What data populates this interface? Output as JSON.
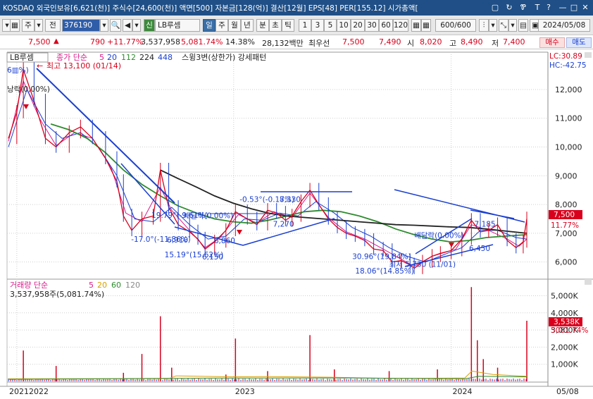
{
  "titlebar": {
    "text": "KOSDAQ 외국인보유[6,621(천)] 주식수[24,600(천)] 액면[500] 자본금[128(억)] 결산[12월] EPS[48] PER[155.12] 시가총액[",
    "icons": [
      "window-icon",
      "sync-icon",
      "pin-icon",
      "text-icon",
      "help-icon",
      "minimize-icon",
      "maximize-icon",
      "close-icon"
    ],
    "buttons": [
      "▢",
      "↻",
      "Ꮘ",
      "T",
      "?",
      "—",
      "□",
      "✕"
    ]
  },
  "toolbar": {
    "market_label": "주",
    "period_label": "전",
    "code": "376190",
    "stock_name": "LB루셈",
    "period_tabs": [
      "일",
      "주",
      "월",
      "년",
      "분",
      "초",
      "틱"
    ],
    "selected_tab": "일",
    "minute_options": [
      "1",
      "3",
      "5",
      "10",
      "20",
      "30",
      "60",
      "120"
    ],
    "count": "600/600",
    "date": "2024/05/08",
    "new_badge": "신"
  },
  "quote": {
    "price": "7,500",
    "arrow": "▲",
    "change": "790",
    "change_pct": "+11.77%",
    "volume": "3,537,958",
    "volume_pct": "5,081.74%",
    "turnover_pct": "14.38%",
    "amount": "28,132백만",
    "ask_label": "최우선",
    "ask": "7,500",
    "bid": "7,490",
    "open_label": "시",
    "open": "8,020",
    "high_label": "고",
    "high": "8,490",
    "low_label": "저",
    "low": "7,400",
    "buy_label": "매수",
    "sell_label": "매도"
  },
  "chart_panel": {
    "name": "LB루셈",
    "ma_label": "종가 단순",
    "ma_periods": [
      "5",
      "20",
      "112",
      "224",
      "448"
    ],
    "pattern_label": "스윙3변(상한가) 강세패턴",
    "lc": "LC:30.89",
    "hc": "HC:-42.75",
    "max_label": "최고 13,100 (01/14)",
    "corner_label": "6▥%)",
    "left_label": "낭락(0,00%)",
    "price_tag": "7,500",
    "pct_tag": "11.77%",
    "annotations": [
      {
        "text": "-0.53°(-0.17%)",
        "x": "2023-01-12",
        "y": 8090
      },
      {
        "text": "8,330",
        "x": "2023-03-20",
        "y": 8090
      },
      {
        "text": "19.79°(-9.61%)",
        "x": "2022-08-17",
        "y": 7540
      },
      {
        "text": "배달락(0.00%)",
        "x": "2022-10-10",
        "y": 7520
      },
      {
        "text": "-17.0°(-11.86%)",
        "x": "2022-07-14",
        "y": 6700
      },
      {
        "text": "6,910",
        "x": "2022-09-12",
        "y": 6680
      },
      {
        "text": "6,860",
        "x": "2022-11-30",
        "y": 6650
      },
      {
        "text": "7,270",
        "x": "2023-03-09",
        "y": 7230
      },
      {
        "text": "15.19°(15.62%)",
        "x": "2022-09-08",
        "y": 6170
      },
      {
        "text": "6,150",
        "x": "2022-11-10",
        "y": 6090
      },
      {
        "text": "30.96°(19.84%)",
        "x": "2023-07-20",
        "y": 6100
      },
      {
        "text": "최저 5,730 (11/01)",
        "x": "2023-09-20",
        "y": 5830
      },
      {
        "text": "18.06°(14.85%)",
        "x": "2023-07-25",
        "y": 5600
      },
      {
        "text": "배달락(0.00%)",
        "x": "2023-11-01",
        "y": 6840
      },
      {
        "text": "7,185",
        "x": "2024-02-10",
        "y": 7230
      },
      {
        "text": "6,450",
        "x": "2024-02-01",
        "y": 6380
      }
    ]
  },
  "volume_panel": {
    "label": "거래량 단순",
    "ma_periods": [
      "5",
      "20",
      "60",
      "120"
    ],
    "volume_text": "3,537,958주(5,081.74%)",
    "tag_value": "3,538K",
    "tag_pct": "5081.74%"
  },
  "colors": {
    "up": "#d8001c",
    "down": "#1a3fd0",
    "ma5": "#d81b8b",
    "ma20": "#1a3fd0",
    "ma112": "#2e8b2e",
    "ma224": "#222222",
    "ma448": "#e07800",
    "trend": "#1a3fd0"
  },
  "chart_data": [
    {
      "type": "line",
      "title": "LB루셈",
      "x_start": "2021-12-20",
      "x_end": "2024-05-08",
      "ylim": [
        5600,
        13200
      ],
      "y_ticks": [
        6000,
        7000,
        8000,
        9000,
        10000,
        11000,
        12000
      ],
      "y_tick_labels": [
        "6,000",
        "7,000",
        "8,000",
        "9,000",
        "10,000",
        "11,000",
        "12,000"
      ],
      "x_tick_labels": [
        {
          "x": "2021-12-20",
          "text": "2021"
        },
        {
          "x": "2022-01-03",
          "text": "2022"
        },
        {
          "x": "2023-01-02",
          "text": "2023"
        },
        {
          "x": "2024-01-02",
          "text": "2024"
        },
        {
          "x": "2024-05-08",
          "text": "05/08"
        }
      ],
      "grid": true,
      "series": [
        {
          "name": "종가",
          "points": [
            [
              "2021-12-20",
              10300
            ],
            [
              "2022-01-03",
              11200
            ],
            [
              "2022-01-14",
              12700
            ],
            [
              "2022-02-01",
              11600
            ],
            [
              "2022-02-20",
              10300
            ],
            [
              "2022-03-10",
              10000
            ],
            [
              "2022-04-01",
              10500
            ],
            [
              "2022-04-20",
              10700
            ],
            [
              "2022-05-10",
              10300
            ],
            [
              "2022-06-01",
              9600
            ],
            [
              "2022-06-20",
              8800
            ],
            [
              "2022-07-01",
              7600
            ],
            [
              "2022-07-15",
              7100
            ],
            [
              "2022-08-01",
              7500
            ],
            [
              "2022-08-20",
              7600
            ],
            [
              "2022-09-01",
              9200
            ],
            [
              "2022-09-15",
              7900
            ],
            [
              "2022-10-01",
              7300
            ],
            [
              "2022-10-20",
              7050
            ],
            [
              "2022-11-03",
              6800
            ],
            [
              "2022-11-15",
              6450
            ],
            [
              "2022-12-01",
              6700
            ],
            [
              "2022-12-20",
              7100
            ],
            [
              "2023-01-05",
              7750
            ],
            [
              "2023-01-25",
              7500
            ],
            [
              "2023-02-10",
              7300
            ],
            [
              "2023-02-28",
              7800
            ],
            [
              "2023-03-15",
              7700
            ],
            [
              "2023-03-30",
              7450
            ],
            [
              "2023-04-10",
              7600
            ],
            [
              "2023-04-25",
              8100
            ],
            [
              "2023-05-10",
              8500
            ],
            [
              "2023-05-25",
              8000
            ],
            [
              "2023-06-10",
              7500
            ],
            [
              "2023-06-25",
              7200
            ],
            [
              "2023-07-10",
              7000
            ],
            [
              "2023-07-25",
              6900
            ],
            [
              "2023-08-10",
              6750
            ],
            [
              "2023-08-25",
              6450
            ],
            [
              "2023-09-10",
              6400
            ],
            [
              "2023-09-25",
              6000
            ],
            [
              "2023-10-10",
              6050
            ],
            [
              "2023-10-25",
              5900
            ],
            [
              "2023-11-01",
              5780
            ],
            [
              "2023-11-15",
              6000
            ],
            [
              "2023-12-01",
              6200
            ],
            [
              "2023-12-15",
              6300
            ],
            [
              "2024-01-02",
              6400
            ],
            [
              "2024-01-20",
              6800
            ],
            [
              "2024-02-05",
              7450
            ],
            [
              "2024-02-20",
              7050
            ],
            [
              "2024-03-05",
              7100
            ],
            [
              "2024-03-20",
              7300
            ],
            [
              "2024-04-05",
              6750
            ],
            [
              "2024-04-20",
              6500
            ],
            [
              "2024-05-02",
              6700
            ],
            [
              "2024-05-08",
              7500
            ]
          ]
        },
        {
          "name": "5",
          "points": [
            [
              "2021-12-20",
              10200
            ],
            [
              "2022-01-14",
              12300
            ],
            [
              "2022-02-10",
              11000
            ],
            [
              "2022-03-10",
              10050
            ],
            [
              "2022-04-10",
              10500
            ],
            [
              "2022-05-10",
              10300
            ],
            [
              "2022-06-10",
              9300
            ],
            [
              "2022-07-05",
              7700
            ],
            [
              "2022-08-01",
              7400
            ],
            [
              "2022-09-01",
              8600
            ],
            [
              "2022-09-20",
              7800
            ],
            [
              "2022-10-20",
              7100
            ],
            [
              "2022-11-15",
              6500
            ],
            [
              "2022-12-10",
              6850
            ],
            [
              "2023-01-10",
              7650
            ],
            [
              "2023-02-10",
              7350
            ],
            [
              "2023-03-10",
              7750
            ],
            [
              "2023-04-10",
              7550
            ],
            [
              "2023-05-10",
              8400
            ],
            [
              "2023-06-10",
              7550
            ],
            [
              "2023-07-10",
              7050
            ],
            [
              "2023-08-10",
              6800
            ],
            [
              "2023-09-10",
              6450
            ],
            [
              "2023-10-10",
              6100
            ],
            [
              "2023-11-01",
              5850
            ],
            [
              "2023-12-01",
              6200
            ],
            [
              "2024-01-10",
              6450
            ],
            [
              "2024-02-05",
              7300
            ],
            [
              "2024-03-05",
              7100
            ],
            [
              "2024-04-05",
              6800
            ],
            [
              "2024-04-25",
              6550
            ],
            [
              "2024-05-08",
              6800
            ]
          ]
        },
        {
          "name": "20",
          "points": [
            [
              "2021-12-20",
              10000
            ],
            [
              "2022-01-20",
              12000
            ],
            [
              "2022-02-20",
              10800
            ],
            [
              "2022-03-20",
              10300
            ],
            [
              "2022-04-20",
              10500
            ],
            [
              "2022-05-20",
              10000
            ],
            [
              "2022-06-20",
              9000
            ],
            [
              "2022-07-20",
              7500
            ],
            [
              "2022-08-20",
              7400
            ],
            [
              "2022-09-20",
              7900
            ],
            [
              "2022-10-20",
              7300
            ],
            [
              "2022-11-20",
              6800
            ],
            [
              "2022-12-20",
              6900
            ],
            [
              "2023-01-20",
              7500
            ],
            [
              "2023-02-20",
              7450
            ],
            [
              "2023-03-20",
              7700
            ],
            [
              "2023-04-20",
              7600
            ],
            [
              "2023-05-20",
              8100
            ],
            [
              "2023-06-20",
              7700
            ],
            [
              "2023-07-20",
              7200
            ],
            [
              "2023-08-20",
              6900
            ],
            [
              "2023-09-20",
              6500
            ],
            [
              "2023-10-20",
              6200
            ],
            [
              "2023-11-20",
              6000
            ],
            [
              "2023-12-20",
              6250
            ],
            [
              "2024-01-20",
              6500
            ],
            [
              "2024-02-20",
              7100
            ],
            [
              "2024-03-20",
              7100
            ],
            [
              "2024-04-20",
              6850
            ],
            [
              "2024-05-08",
              6800
            ]
          ]
        },
        {
          "name": "112",
          "points": [
            [
              "2022-03-01",
              10800
            ],
            [
              "2022-04-01",
              10600
            ],
            [
              "2022-05-01",
              10300
            ],
            [
              "2022-06-01",
              9800
            ],
            [
              "2022-07-01",
              9200
            ],
            [
              "2022-08-01",
              8700
            ],
            [
              "2022-09-01",
              8300
            ],
            [
              "2022-10-01",
              7950
            ],
            [
              "2022-11-01",
              7700
            ],
            [
              "2022-12-01",
              7500
            ],
            [
              "2023-01-01",
              7400
            ],
            [
              "2023-02-01",
              7350
            ],
            [
              "2023-03-01",
              7450
            ],
            [
              "2023-04-01",
              7600
            ],
            [
              "2023-05-01",
              7750
            ],
            [
              "2023-06-01",
              7800
            ],
            [
              "2023-07-01",
              7750
            ],
            [
              "2023-08-01",
              7600
            ],
            [
              "2023-09-01",
              7400
            ],
            [
              "2023-10-01",
              7150
            ],
            [
              "2023-11-01",
              6950
            ],
            [
              "2023-12-01",
              6800
            ],
            [
              "2024-01-01",
              6700
            ],
            [
              "2024-02-01",
              6750
            ],
            [
              "2024-03-01",
              6850
            ],
            [
              "2024-04-01",
              6900
            ],
            [
              "2024-05-08",
              6950
            ]
          ]
        },
        {
          "name": "224",
          "points": [
            [
              "2022-09-01",
              9200
            ],
            [
              "2022-10-01",
              8900
            ],
            [
              "2022-11-01",
              8600
            ],
            [
              "2022-12-01",
              8300
            ],
            [
              "2023-01-01",
              8050
            ],
            [
              "2023-02-01",
              7850
            ],
            [
              "2023-03-01",
              7700
            ],
            [
              "2023-04-01",
              7600
            ],
            [
              "2023-05-01",
              7550
            ],
            [
              "2023-06-01",
              7500
            ],
            [
              "2023-07-01",
              7450
            ],
            [
              "2023-08-01",
              7400
            ],
            [
              "2023-09-01",
              7350
            ],
            [
              "2023-10-01",
              7300
            ],
            [
              "2023-11-01",
              7280
            ],
            [
              "2023-12-01",
              7250
            ],
            [
              "2024-01-01",
              7220
            ],
            [
              "2024-02-01",
              7200
            ],
            [
              "2024-03-01",
              7150
            ],
            [
              "2024-04-01",
              7080
            ],
            [
              "2024-05-08",
              7000
            ]
          ]
        }
      ]
    },
    {
      "type": "bar",
      "title": "거래량",
      "ylim": [
        0,
        5800
      ],
      "y_ticks": [
        1000,
        2000,
        3000,
        4000,
        5000
      ],
      "y_tick_labels": [
        "1,000K",
        "2,000K",
        "3,000K",
        "4,000K",
        "5,000K"
      ],
      "spikes": [
        [
          "2022-01-14",
          1800
        ],
        [
          "2022-03-10",
          900
        ],
        [
          "2022-07-01",
          500
        ],
        [
          "2022-08-01",
          1600
        ],
        [
          "2022-09-01",
          3800
        ],
        [
          "2022-09-20",
          800
        ],
        [
          "2022-12-20",
          400
        ],
        [
          "2023-01-05",
          2500
        ],
        [
          "2023-02-28",
          600
        ],
        [
          "2023-05-10",
          2700
        ],
        [
          "2023-06-20",
          700
        ],
        [
          "2023-09-20",
          600
        ],
        [
          "2023-12-10",
          700
        ],
        [
          "2024-02-05",
          5500
        ],
        [
          "2024-02-15",
          2400
        ],
        [
          "2024-02-25",
          1300
        ],
        [
          "2024-03-20",
          800
        ],
        [
          "2024-05-08",
          3538
        ]
      ],
      "baseline": 120
    }
  ]
}
